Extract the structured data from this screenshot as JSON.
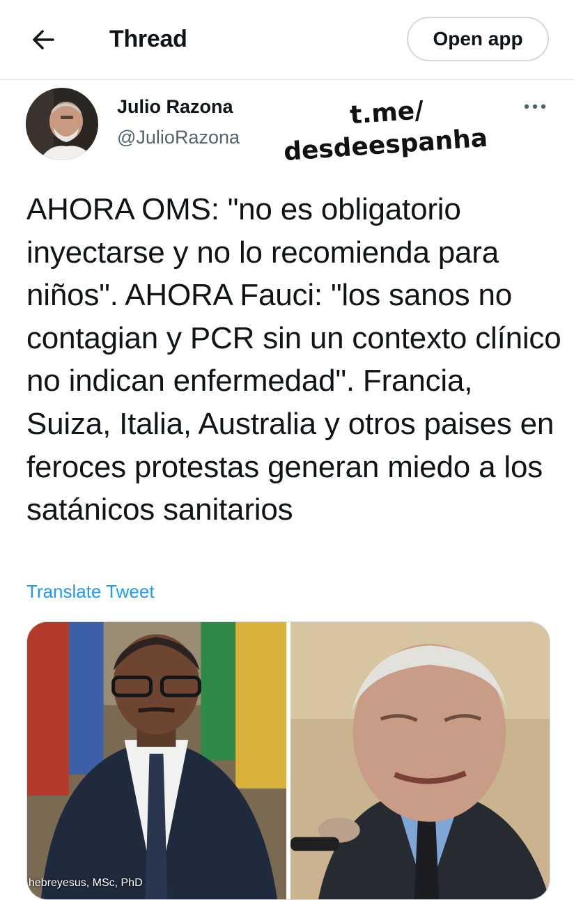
{
  "header": {
    "title": "Thread",
    "open_app_label": "Open app",
    "icons": {
      "back": "arrow-left-icon"
    }
  },
  "tweet": {
    "author_name": "Julio Razona",
    "author_handle": "@JulioRazona",
    "text": "AHORA OMS:  \"no es obligatorio inyectarse y  no lo recomienda para niños\". AHORA Fauci: \"los sanos no contagian  y PCR sin un contexto clínico no indican enfermedad\". Francia, Suiza, Italia, Australia y otros paises en feroces protestas  generan miedo a los satánicos sanitarios",
    "translate_label": "Translate Tweet",
    "more_icon": "more-horizontal-icon",
    "media": [
      {
        "description": "photo-man-glasses-suit-flags",
        "caption": "hebreyesus, MSc, PhD"
      },
      {
        "description": "photo-older-man-suit-speaking"
      }
    ]
  },
  "watermark": {
    "line1": "t.me/",
    "line2": "desdeespanha"
  },
  "colors": {
    "accent": "#1d9bf0",
    "text": "#0f1419",
    "secondary_text": "#536471",
    "border": "#cfd9de"
  }
}
